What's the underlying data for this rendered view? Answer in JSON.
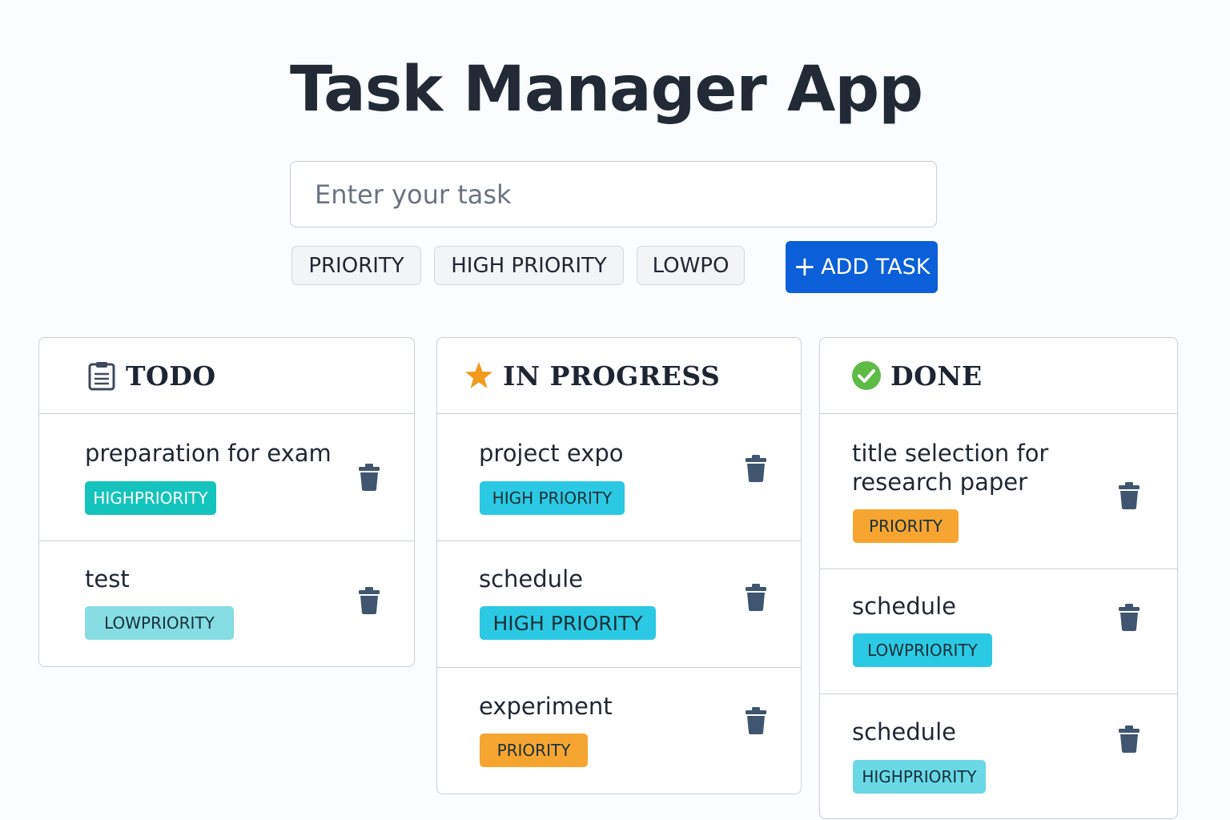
{
  "app": {
    "title": "Task Manager App"
  },
  "form": {
    "placeholder": "Enter your task",
    "priority_options": [
      "PRIORITY",
      "HIGH PRIORITY",
      "LOWPO"
    ],
    "add_label": "ADD TASK",
    "add_icon": "plus-icon"
  },
  "columns": [
    {
      "title": "TODO",
      "icon": "clipboard-icon",
      "tasks": [
        {
          "title": "preparation for exam",
          "badge": "HIGHPRIORITY",
          "badge_color": "#14c4bc"
        },
        {
          "title": "test",
          "badge": "LOWPRIORITY",
          "badge_color": "#86dde3"
        }
      ]
    },
    {
      "title": "IN PROGRESS",
      "icon": "star-icon",
      "tasks": [
        {
          "title": "project expo",
          "badge": "HIGH PRIORITY",
          "badge_color": "#2bc9e3"
        },
        {
          "title": "schedule",
          "badge": "HIGH PRIORITY",
          "badge_color": "#2bc9e3"
        },
        {
          "title": "experiment",
          "badge": "PRIORITY",
          "badge_color": "#f7a531"
        }
      ]
    },
    {
      "title": "DONE",
      "icon": "check-circle-icon",
      "tasks": [
        {
          "title": "title selection for research paper",
          "badge": "PRIORITY",
          "badge_color": "#f7a531"
        },
        {
          "title": "schedule",
          "badge": "LOWPRIORITY",
          "badge_color": "#2bc9e3"
        },
        {
          "title": "schedule",
          "badge": "HIGHPRIORITY",
          "badge_color": "#6ad8e5"
        }
      ]
    }
  ],
  "colors": {
    "accent": "#0b5fd8",
    "trash": "#3f5570",
    "star": "#f29a1c",
    "check": "#5dbb46"
  }
}
